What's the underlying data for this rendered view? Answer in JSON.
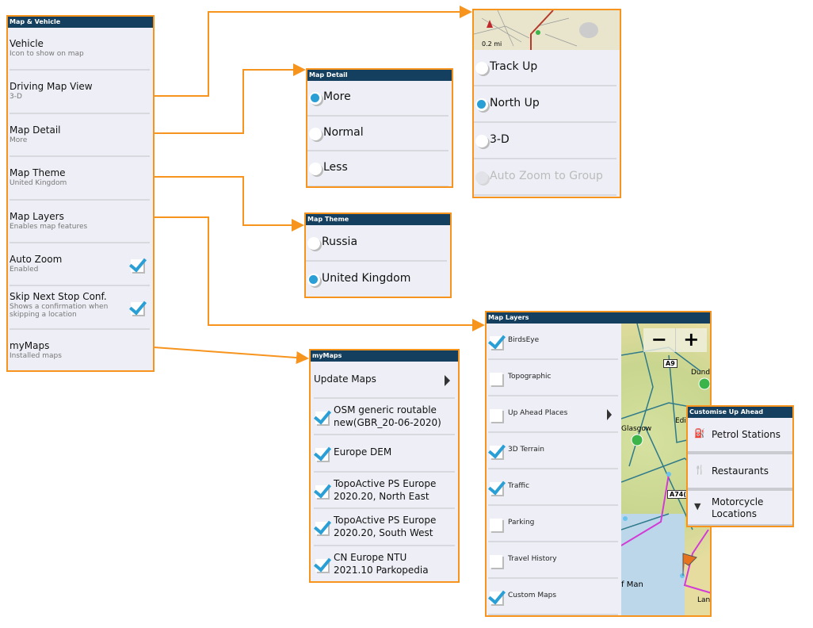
{
  "accent": "#f7941d",
  "header_color": "#143f5e",
  "selected_color": "#2a9fd6",
  "map_vehicle": {
    "title": "Map & Vehicle",
    "items": [
      {
        "label": "Vehicle",
        "sub": "Icon to show on map"
      },
      {
        "label": "Driving Map View",
        "sub": "3-D"
      },
      {
        "label": "Map Detail",
        "sub": "More"
      },
      {
        "label": "Map Theme",
        "sub": "United Kingdom"
      },
      {
        "label": "Map Layers",
        "sub": "Enables map features"
      },
      {
        "label": "Auto Zoom",
        "sub": "Enabled",
        "checked": true
      },
      {
        "label": "Skip Next Stop Conf.",
        "sub": "Shows a confirmation when skipping a location",
        "checked": true
      },
      {
        "label": "myMaps",
        "sub": "Installed maps"
      }
    ]
  },
  "driving_view": {
    "scale": "0.2 mi",
    "options": [
      {
        "label": "Track Up",
        "selected": false
      },
      {
        "label": "North Up",
        "selected": true
      },
      {
        "label": "3-D",
        "selected": false
      },
      {
        "label": "Auto Zoom to Group",
        "selected": false,
        "disabled": true
      }
    ]
  },
  "map_detail": {
    "title": "Map Detail",
    "options": [
      {
        "label": "More",
        "selected": true
      },
      {
        "label": "Normal",
        "selected": false
      },
      {
        "label": "Less",
        "selected": false
      }
    ]
  },
  "map_theme": {
    "title": "Map Theme",
    "options": [
      {
        "label": "Russia",
        "selected": false
      },
      {
        "label": "United Kingdom",
        "selected": true
      }
    ]
  },
  "my_maps": {
    "title": "myMaps",
    "update": "Update Maps",
    "maps": [
      {
        "l1": "OSM generic routable",
        "l2": "new(GBR_20-06-2020)",
        "checked": true
      },
      {
        "l1": "Europe DEM",
        "l2": "",
        "checked": true
      },
      {
        "l1": "TopoActive PS Europe",
        "l2": "2020.20, North East",
        "checked": true
      },
      {
        "l1": "TopoActive PS Europe",
        "l2": "2020.20, South West",
        "checked": true
      },
      {
        "l1": "CN Europe NTU",
        "l2": "2021.10 Parkopedia",
        "checked": true
      }
    ]
  },
  "map_layers": {
    "title": "Map Layers",
    "items": [
      {
        "label": "BirdsEye",
        "checked": true
      },
      {
        "label": "Topographic",
        "checked": false
      },
      {
        "label": "Up Ahead Places",
        "checked": false,
        "submenu": true
      },
      {
        "label": "3D Terrain",
        "checked": true
      },
      {
        "label": "Traffic",
        "checked": true
      },
      {
        "label": "Parking",
        "checked": false
      },
      {
        "label": "Travel History",
        "checked": false
      },
      {
        "label": "Custom Maps",
        "checked": true
      }
    ],
    "map": {
      "zoom_out": "−",
      "zoom_in": "+",
      "road_a9": "A9",
      "road_a74": "A74(",
      "glasgow": "Glasgow",
      "dundee": "Dunde",
      "edinburgh": "Edi",
      "isle_of_man": "f Man",
      "lancaster": "Lan"
    }
  },
  "up_ahead": {
    "title": "Customise Up Ahead",
    "items": [
      {
        "label": "Petrol Stations",
        "icon": "fuel-icon"
      },
      {
        "label": "Restaurants",
        "icon": "fork-knife-icon"
      },
      {
        "label": "Motorcycle Locations",
        "icon": "motorcycle-pin-icon"
      }
    ]
  }
}
